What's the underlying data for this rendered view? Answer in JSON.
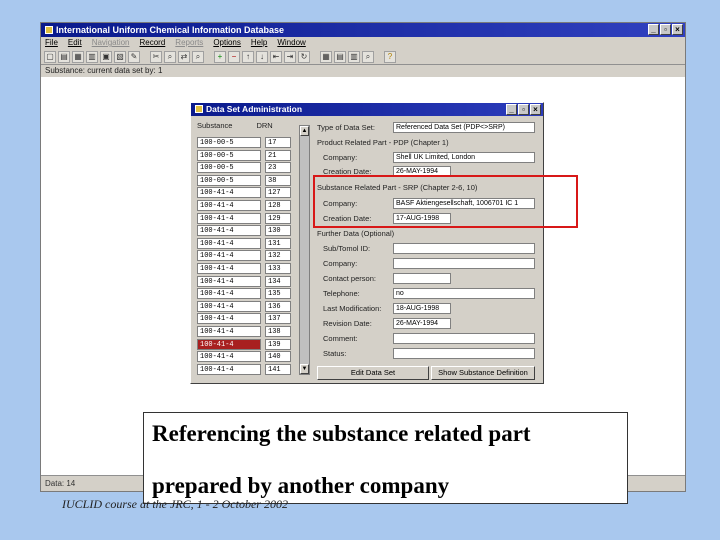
{
  "app": {
    "title": "International Uniform Chemical Information Database",
    "menu": [
      {
        "label": "File",
        "enabled": true
      },
      {
        "label": "Edit",
        "enabled": true
      },
      {
        "label": "Navigation",
        "enabled": false
      },
      {
        "label": "Record",
        "enabled": true
      },
      {
        "label": "Reports",
        "enabled": false
      },
      {
        "label": "Options",
        "enabled": true
      },
      {
        "label": "Help",
        "enabled": true
      },
      {
        "label": "Window",
        "enabled": true
      }
    ],
    "status_text": "Substance: current data set by: 1",
    "bottom_status": "Data: 14"
  },
  "dialog": {
    "title": "Data Set Administration",
    "list_header": {
      "col1": "Substance",
      "col2": "DRN"
    },
    "rows": [
      {
        "substance": "100-00-5",
        "id": "17"
      },
      {
        "substance": "100-00-5",
        "id": "21"
      },
      {
        "substance": "100-00-5",
        "id": "23"
      },
      {
        "substance": "100-00-5",
        "id": "38"
      },
      {
        "substance": "100-41-4",
        "id": "127"
      },
      {
        "substance": "100-41-4",
        "id": "128"
      },
      {
        "substance": "100-41-4",
        "id": "129"
      },
      {
        "substance": "100-41-4",
        "id": "130"
      },
      {
        "substance": "100-41-4",
        "id": "131"
      },
      {
        "substance": "100-41-4",
        "id": "132"
      },
      {
        "substance": "100-41-4",
        "id": "133"
      },
      {
        "substance": "100-41-4",
        "id": "134"
      },
      {
        "substance": "100-41-4",
        "id": "135"
      },
      {
        "substance": "100-41-4",
        "id": "136"
      },
      {
        "substance": "100-41-4",
        "id": "137"
      },
      {
        "substance": "100-41-4",
        "id": "138"
      },
      {
        "substance": "100-41-4",
        "id": "139",
        "selected": true
      },
      {
        "substance": "100-41-4",
        "id": "140"
      },
      {
        "substance": "100-41-4",
        "id": "141"
      }
    ],
    "type_label": "Type of Data Set:",
    "type_value": "Referenced Data Set (PDP<>SRP)",
    "product_section": "Product Related Part - PDP (Chapter 1)",
    "company_label": "Company:",
    "company_value": "Shell UK Limited, London",
    "creation_label": "Creation Date:",
    "creation_value": "26-MAY-1994",
    "substance_section": "Substance Related Part - SRP (Chapter 2-6, 10)",
    "srp_company_label": "Company:",
    "srp_company_value": "BASF Aktiengesellschaft, 1006701 IC 1",
    "srp_creation_label": "Creation Date:",
    "srp_creation_value": "17-AUG-1998",
    "other_section": "Further Data (Optional)",
    "sub_label": "Sub/Tomol ID:",
    "company2_label": "Company:",
    "contact_label": "Contact person:",
    "tel_label": "Telephone:",
    "tel_value": "no",
    "last_label": "Last Modification:",
    "last_value": "18-AUG-1998",
    "revision_label": "Revision Date:",
    "revision_value": "26-MAY-1994",
    "comment_label": "Comment:",
    "status_label": "Status:",
    "edit_button": "Edit Data Set",
    "show_button": "Show Substance Definition"
  },
  "caption": {
    "line1": "Referencing the substance related part",
    "line2": "prepared by another company"
  },
  "footer": "IUCLID course at the JRC, 1 - 2 October 2002",
  "colors": {
    "desktop": "#a9c8ee",
    "titlebar": "#0a1a8c",
    "highlight": "#d81818",
    "selected_row": "#a82020"
  }
}
